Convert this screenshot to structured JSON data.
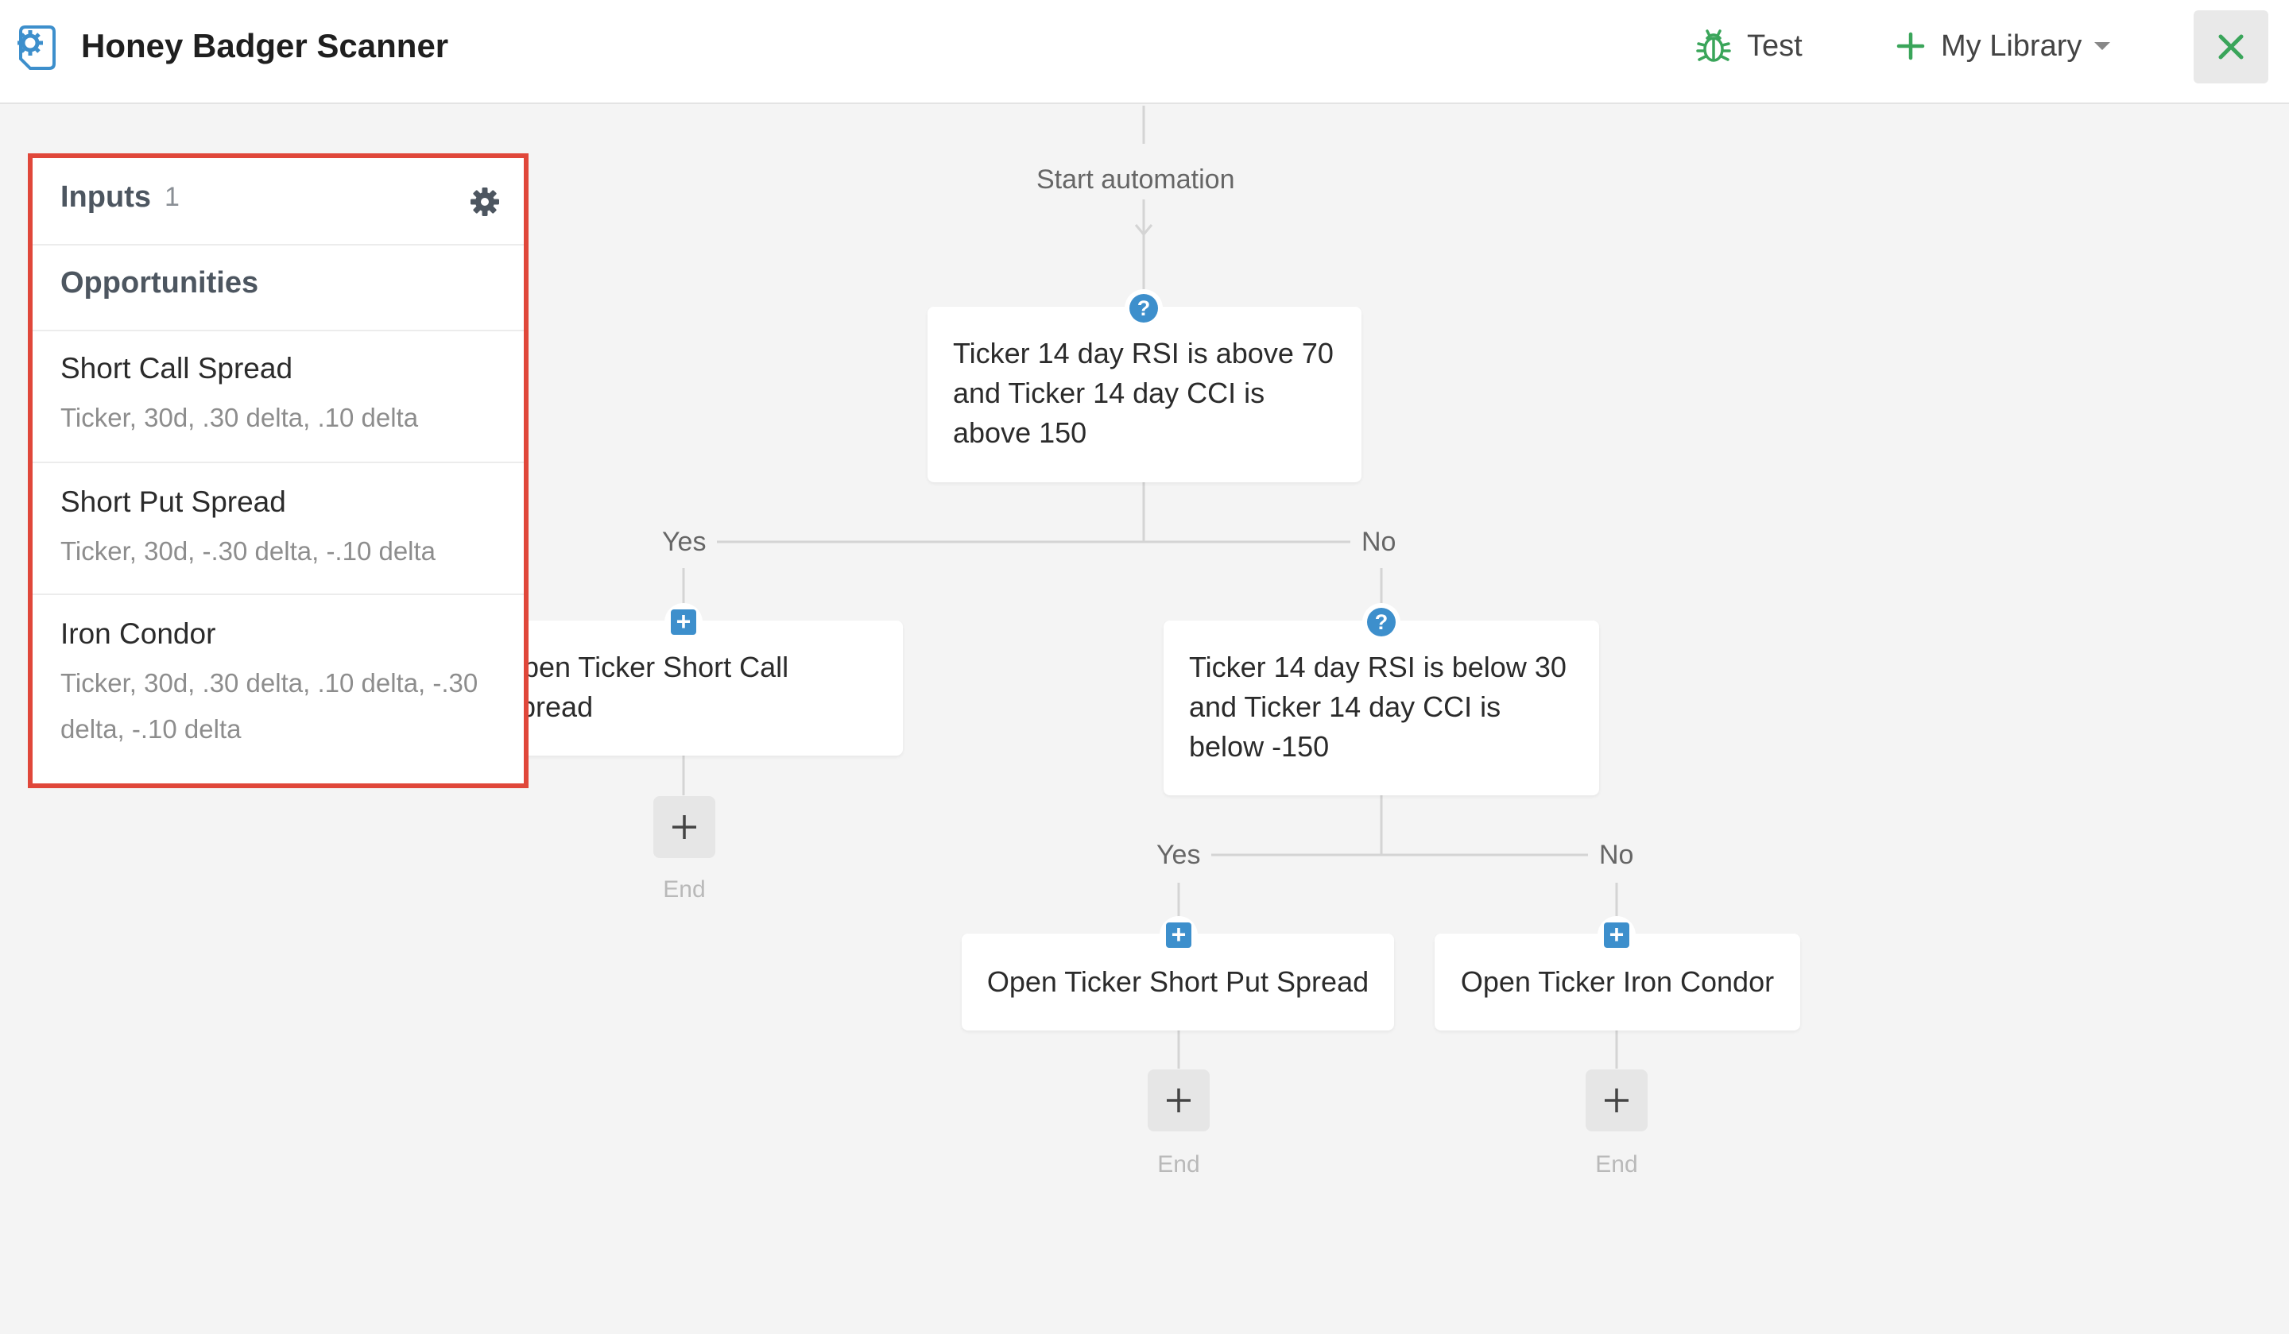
{
  "app": {
    "title": "Honey Badger Scanner",
    "icon": "gear-document-icon"
  },
  "header": {
    "test_label": "Test",
    "library_label": "My Library",
    "test_icon": "bug-icon",
    "library_icon": "plus-icon",
    "close_icon": "close-icon"
  },
  "flow": {
    "start_label": "Start automation",
    "condition_1": {
      "line1": "Ticker 14 day RSI is above 70",
      "line2": "and Ticker 14 day CCI is",
      "line3": "above 150"
    },
    "yes_label": "Yes",
    "no_label": "No",
    "action_yes": {
      "line1": "Open Ticker Short Call",
      "line2": "Spread"
    },
    "condition_2": {
      "line1": "Ticker 14 day RSI is below 30",
      "line2": "and Ticker 14 day CCI is",
      "line3": "below -150"
    },
    "yes2_label": "Yes",
    "no2_label": "No",
    "action_put": "Open Ticker Short Put Spread",
    "action_condor": "Open Ticker Iron Condor",
    "end_label": "End"
  },
  "inputs_panel": {
    "title": "Inputs",
    "count": "1",
    "section": "Opportunities",
    "items": [
      {
        "name": "Short Call Spread",
        "detail": "Ticker, 30d, .30 delta, .10 delta"
      },
      {
        "name": "Short Put Spread",
        "detail": "Ticker, 30d, -.30 delta, -.10 delta"
      },
      {
        "name": "Iron Condor",
        "detail": "Ticker, 30d, .30 delta, .10 delta, -.30 delta, -.10 delta"
      }
    ]
  },
  "colors": {
    "accent_blue": "#3d8fcc",
    "green": "#3aa55a",
    "highlight_red": "#e0473a"
  }
}
